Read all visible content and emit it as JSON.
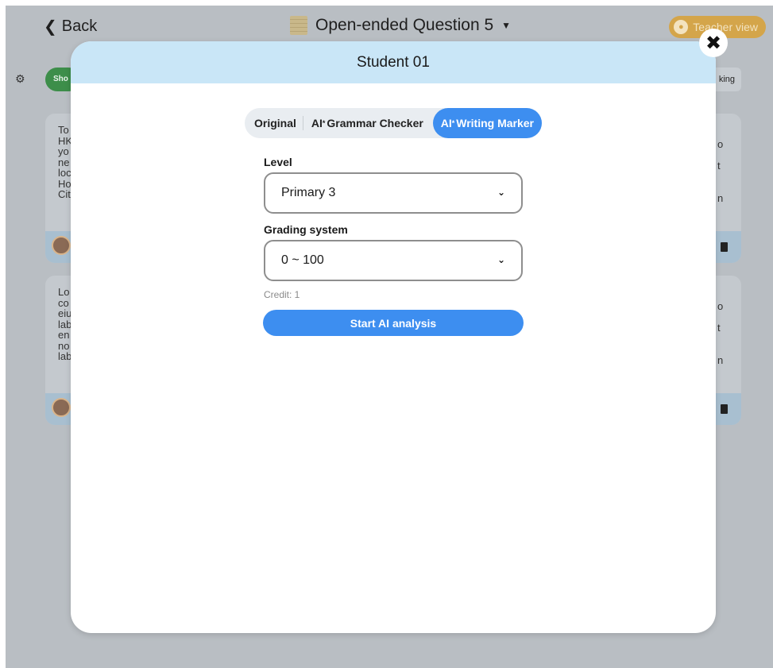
{
  "header": {
    "back_label": "Back",
    "title": "Open-ended Question 5",
    "teacher_view_label": "Teacher view"
  },
  "toolbar": {
    "show_label": "Sho",
    "marking_label": "king"
  },
  "background_cards": [
    {
      "left_text": "To\nHK\nyo\nne\nloc\nHo\nCit",
      "right_text": "o\n\nt\n\n\nn"
    },
    {
      "left_text": "Lo\nco\neiu\nlab\nen\nno\nlab",
      "right_text": "o\n\nt\n\n\nn"
    }
  ],
  "modal": {
    "title": "Student 01",
    "tabs": [
      {
        "label": "Original",
        "active": false
      },
      {
        "label": "Grammar Checker",
        "prefix": "AI",
        "active": false
      },
      {
        "label": "Writing Marker",
        "prefix": "AI",
        "active": true
      }
    ],
    "level": {
      "label": "Level",
      "value": "Primary 3"
    },
    "grading_system": {
      "label": "Grading system",
      "value": "0 ~ 100"
    },
    "credit_text": "Credit: 1",
    "start_button_label": "Start AI analysis"
  },
  "colors": {
    "accent_blue": "#3d8ef0",
    "header_blue": "#c9e6f7",
    "teacher_gold": "#d4a54a",
    "show_green": "#3d8e4a"
  }
}
